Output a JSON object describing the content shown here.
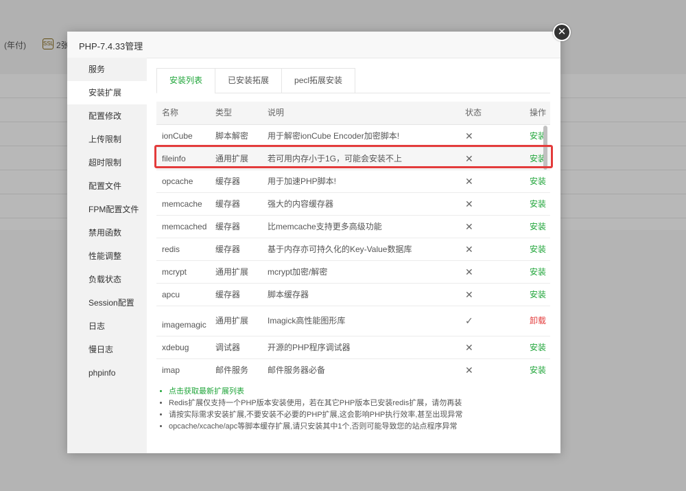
{
  "background": {
    "topbar_text": "(年付)",
    "count_text": "2张"
  },
  "modal": {
    "title": "PHP-7.4.33管理",
    "close_glyph": "✕"
  },
  "sidebar": {
    "items": [
      {
        "label": "服务"
      },
      {
        "label": "安装扩展"
      },
      {
        "label": "配置修改"
      },
      {
        "label": "上传限制"
      },
      {
        "label": "超时限制"
      },
      {
        "label": "配置文件"
      },
      {
        "label": "FPM配置文件"
      },
      {
        "label": "禁用函数"
      },
      {
        "label": "性能调整"
      },
      {
        "label": "负载状态"
      },
      {
        "label": "Session配置"
      },
      {
        "label": "日志"
      },
      {
        "label": "慢日志"
      },
      {
        "label": "phpinfo"
      }
    ]
  },
  "tabs": [
    {
      "label": "安装列表"
    },
    {
      "label": "已安装拓展"
    },
    {
      "label": "pecl拓展安装"
    }
  ],
  "table": {
    "headers": {
      "name": "名称",
      "type": "类型",
      "desc": "说明",
      "status": "状态",
      "op": "操作"
    },
    "rows": [
      {
        "name": "ionCube",
        "type": "脚本解密",
        "desc": "用于解密ionCube Encoder加密脚本!",
        "status": "✕",
        "op": "安装"
      },
      {
        "name": "fileinfo",
        "type": "通用扩展",
        "desc": "若可用内存小于1G，可能会安装不上",
        "status": "✕",
        "op": "安装"
      },
      {
        "name": "opcache",
        "type": "缓存器",
        "desc": "用于加速PHP脚本!",
        "status": "✕",
        "op": "安装"
      },
      {
        "name": "memcache",
        "type": "缓存器",
        "desc": "强大的内容缓存器",
        "status": "✕",
        "op": "安装"
      },
      {
        "name": "memcached",
        "type": "缓存器",
        "desc": "比memcache支持更多高级功能",
        "status": "✕",
        "op": "安装"
      },
      {
        "name": "redis",
        "type": "缓存器",
        "desc": "基于内存亦可持久化的Key-Value数据库",
        "status": "✕",
        "op": "安装"
      },
      {
        "name": "mcrypt",
        "type": "通用扩展",
        "desc": "mcrypt加密/解密",
        "status": "✕",
        "op": "安装"
      },
      {
        "name": "apcu",
        "type": "缓存器",
        "desc": "脚本缓存器",
        "status": "✕",
        "op": "安装"
      },
      {
        "name": "imagemagick",
        "type": "通用扩展",
        "desc": "Imagick高性能图形库",
        "status": "✓",
        "op": "卸载"
      },
      {
        "name": "xdebug",
        "type": "调试器",
        "desc": "开源的PHP程序调试器",
        "status": "✕",
        "op": "安装"
      },
      {
        "name": "imap",
        "type": "邮件服务",
        "desc": "邮件服务器必备",
        "status": "✕",
        "op": "安装"
      }
    ]
  },
  "notes": [
    "点击获取最新扩展列表",
    "Redis扩展仅支持一个PHP版本安装使用，若在其它PHP版本已安装redis扩展，请勿再装",
    "请按实际需求安装扩展,不要安装不必要的PHP扩展,这会影响PHP执行效率,甚至出现异常",
    "opcache/xcache/apc等脚本缓存扩展,请只安装其中1个,否则可能导致您的站点程序异常"
  ],
  "colors": {
    "install": "#20a53a",
    "uninstall": "#e33b3b",
    "highlight_border": "#e33b3b"
  }
}
